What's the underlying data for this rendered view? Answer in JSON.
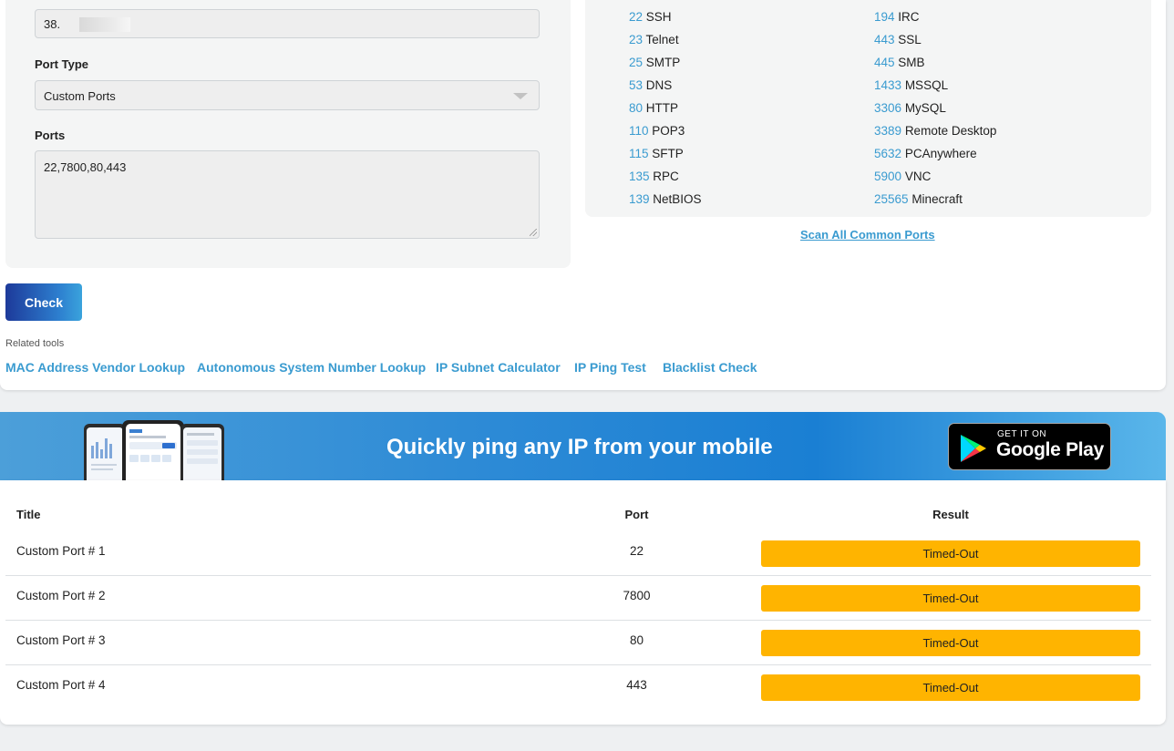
{
  "form": {
    "ip_value": "38.",
    "port_type_label": "Port Type",
    "port_type_value": "Custom Ports",
    "ports_label": "Ports",
    "ports_value": "22,7800,80,443",
    "check_label": "Check"
  },
  "common_ports": {
    "left": [
      {
        "num": "22",
        "name": "SSH"
      },
      {
        "num": "23",
        "name": "Telnet"
      },
      {
        "num": "25",
        "name": "SMTP"
      },
      {
        "num": "53",
        "name": "DNS"
      },
      {
        "num": "80",
        "name": "HTTP"
      },
      {
        "num": "110",
        "name": "POP3"
      },
      {
        "num": "115",
        "name": "SFTP"
      },
      {
        "num": "135",
        "name": "RPC"
      },
      {
        "num": "139",
        "name": "NetBIOS"
      }
    ],
    "right": [
      {
        "num": "194",
        "name": "IRC"
      },
      {
        "num": "443",
        "name": "SSL"
      },
      {
        "num": "445",
        "name": "SMB"
      },
      {
        "num": "1433",
        "name": "MSSQL"
      },
      {
        "num": "3306",
        "name": "MySQL"
      },
      {
        "num": "3389",
        "name": "Remote Desktop"
      },
      {
        "num": "5632",
        "name": "PCAnywhere"
      },
      {
        "num": "5900",
        "name": "VNC"
      },
      {
        "num": "25565",
        "name": "Minecraft"
      }
    ],
    "scan_all_label": "Scan All Common Ports"
  },
  "related": {
    "label": "Related tools",
    "links": [
      "MAC Address Vendor Lookup",
      "Autonomous System Number Lookup",
      "IP Subnet Calculator",
      "IP Ping Test",
      "Blacklist Check"
    ]
  },
  "banner": {
    "text": "Quickly ping any IP from your mobile",
    "store_small": "GET IT ON",
    "store_big": "Google Play"
  },
  "results": {
    "headers": {
      "title": "Title",
      "port": "Port",
      "result": "Result"
    },
    "rows": [
      {
        "title": "Custom Port # 1",
        "port": "22",
        "result": "Timed-Out"
      },
      {
        "title": "Custom Port # 2",
        "port": "7800",
        "result": "Timed-Out"
      },
      {
        "title": "Custom Port # 3",
        "port": "80",
        "result": "Timed-Out"
      },
      {
        "title": "Custom Port # 4",
        "port": "443",
        "result": "Timed-Out"
      }
    ]
  },
  "colors": {
    "accent": "#3a9bd0",
    "result_badge": "#ffb400",
    "button_start": "#1d3a9a",
    "button_end": "#3aa3dc"
  }
}
